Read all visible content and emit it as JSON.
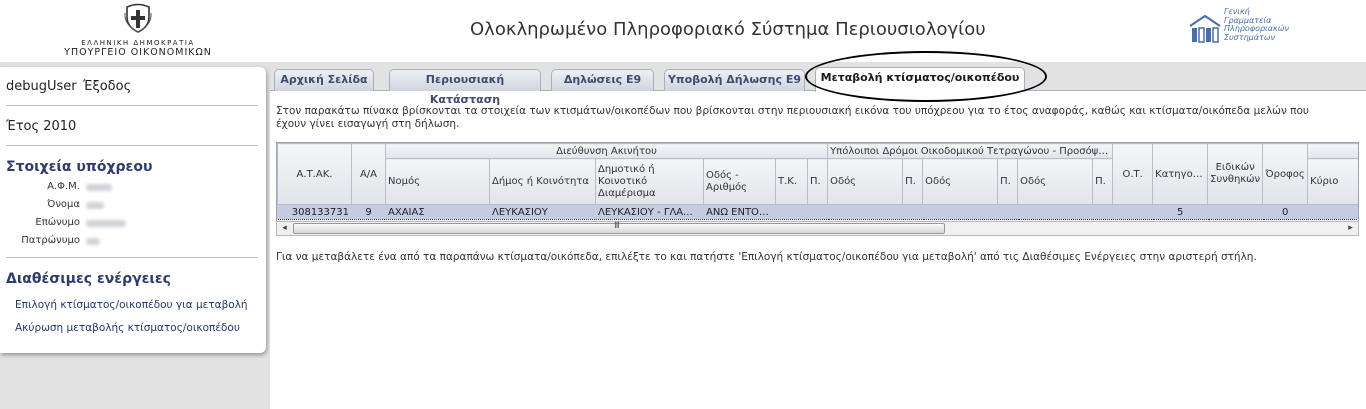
{
  "header": {
    "ministry_line1": "ΕΛΛΗΝΙΚΗ ΔΗΜΟΚΡΑΤΙΑ",
    "ministry_line2": "ΥΠΟΥΡΓΕΙΟ ΟΙΚΟΝΟΜΙΚΩΝ",
    "title": "Ολοκληρωμένο Πληροφοριακό Σύστημα Περιουσιολογίου",
    "gsis_lines": [
      "Γενική",
      "Γραμματεία",
      "Πληροφοριακών",
      "Συστημάτων"
    ]
  },
  "sidebar": {
    "user": "debugUser",
    "logout": "Έξοδος",
    "year": "Έτος 2010",
    "taxpayer_heading": "Στοιχεία υπόχρεου",
    "fields": [
      {
        "label": "Α.Φ.Μ."
      },
      {
        "label": "Όνομα"
      },
      {
        "label": "Επώνυμο"
      },
      {
        "label": "Πατρώνυμο"
      }
    ],
    "actions_heading": "Διαθέσιμες ενέργειες",
    "actions": [
      "Επιλογή κτίσματος/οικοπέδου για μεταβολή",
      "Ακύρωση μεταβολής κτίσματος/οικοπέδου"
    ]
  },
  "tabs": [
    "Αρχική Σελίδα",
    "Περιουσιακή Κατάσταση",
    "Δηλώσεις Ε9",
    "Υποβολή Δήλωσης Ε9",
    "Μεταβολή κτίσματος/οικοπέδου"
  ],
  "content": {
    "intro": "Στον παρακάτω πίνακα βρίσκονται τα στοιχεία των κτισμάτων/οικοπέδων που βρίσκονται στην περιουσιακή εικόνα του υπόχρεου για το έτος αναφοράς, καθώς και κτίσματα/οικόπεδα μελών που έχουν γίνει εισαγωγή στη δήλωση.",
    "group_address": "Διεύθυνση Ακινήτου",
    "group_streets": "Υπόλοιποι Δρόμοι Οικοδομικού Τετραγώνου - Προσόψεις",
    "columns": {
      "atak": "Α.Τ.ΑΚ.",
      "aa": "Α/Α",
      "nomos": "Νομός",
      "dimos": "Δήμος ή Κοινότητα",
      "diamerisma": "Δημοτικό ή Κοινοτικό Διαμέρισμα",
      "odos_arithmos": "Οδός - Αριθμός",
      "tk": "Τ.Κ.",
      "p": "Π.",
      "odos": "Οδός",
      "ot": "Ο.Τ.",
      "katigoria": "Κατηγορία",
      "eidikon": "Ειδικών Συνθηκών",
      "orofos": "Όροφος",
      "kyrios": "Κύριο"
    },
    "rows": [
      {
        "atak": "308133731",
        "aa": "9",
        "nomos": "ΑΧΑΙΑΣ",
        "dimos": "ΛΕΥΚΑΣΙΟΥ",
        "diamerisma": "ΛΕΥΚΑΣΙΟΥ - ΓΛΑ...",
        "odos_arithmos": "ΑΝΩ ΕΝΤΟΣ...",
        "katigoria": "5",
        "orofos": "0"
      }
    ],
    "scroll_grip": "III",
    "hint": "Για να μεταβάλετε ένα από τα παραπάνω κτίσματα/οικόπεδα, επιλέξτε το και πατήστε 'Επιλογή κτίσματος/οικοπέδου για μεταβολή' από τις Διαθέσιμες Ενέργειες στην αριστερή στήλη."
  }
}
